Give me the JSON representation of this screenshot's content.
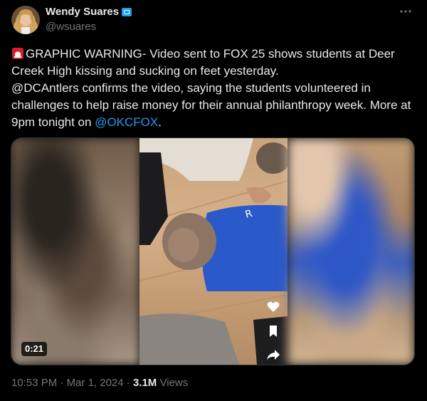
{
  "author": {
    "name": "Wendy Suares",
    "handle": "@wsuares"
  },
  "tweet": {
    "text_before_mention": "GRAPHIC WARNING- Video sent to FOX 25 shows students at Deer Creek High kissing and sucking on feet yesterday.",
    "text_middle": "@DCAntlers confirms the video, saying the students volunteered in challenges to help raise money for their annual philanthropy week. More at 9pm tonight on ",
    "mention": "@OKCFOX",
    "text_end": "."
  },
  "media": {
    "duration": "0:21"
  },
  "meta": {
    "time": "10:53 PM",
    "separator1": " · ",
    "date": "Mar 1, 2024",
    "separator2": " · ",
    "views_count": "3.1M",
    "views_label": " Views"
  },
  "colors": {
    "accent": "#1d9bf0",
    "text": "#e7e9ea",
    "muted": "#71767b",
    "background": "#000000"
  },
  "icons": {
    "verified": "verified-badge-icon",
    "more": "more-icon",
    "siren": "rotating-light-icon",
    "heart": "heart-icon",
    "bookmark": "bookmark-icon",
    "share": "share-icon"
  }
}
